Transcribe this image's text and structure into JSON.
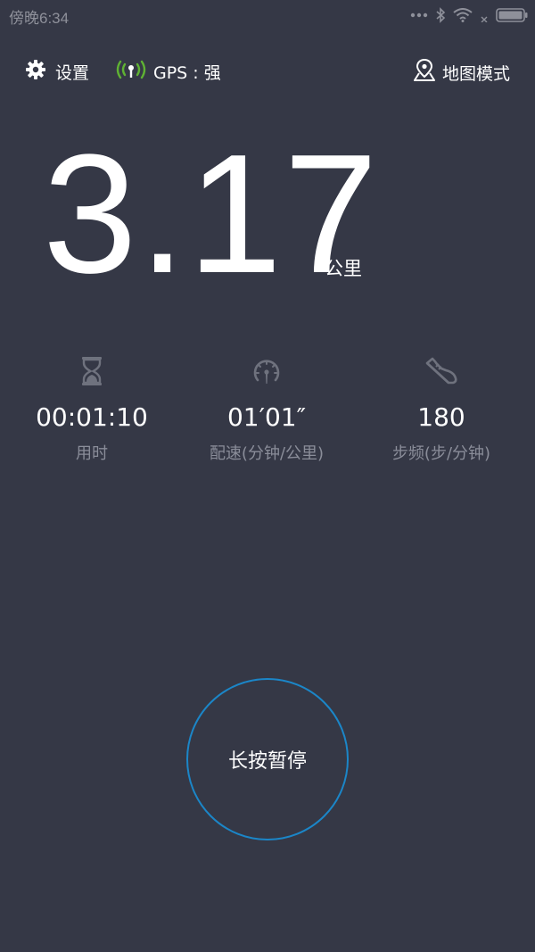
{
  "status_bar": {
    "time": "傍晚6:34"
  },
  "top_bar": {
    "settings_label": "设置",
    "gps_label": "GPS : 强",
    "map_mode_label": "地图模式"
  },
  "distance": {
    "value": "3.17",
    "unit": "公里"
  },
  "stats": [
    {
      "icon": "hourglass-icon",
      "value": "00:01:10",
      "label": "用时"
    },
    {
      "icon": "speedometer-icon",
      "value": "01′01″",
      "label": "配速(分钟/公里)"
    },
    {
      "icon": "shoe-icon",
      "value": "180",
      "label": "步频(步/分钟)"
    }
  ],
  "pause_button": {
    "label": "长按暂停"
  },
  "colors": {
    "background": "#353846",
    "accent_ring": "#1b86c8",
    "gps_green": "#5fb233",
    "muted_text": "#8a8d99"
  }
}
